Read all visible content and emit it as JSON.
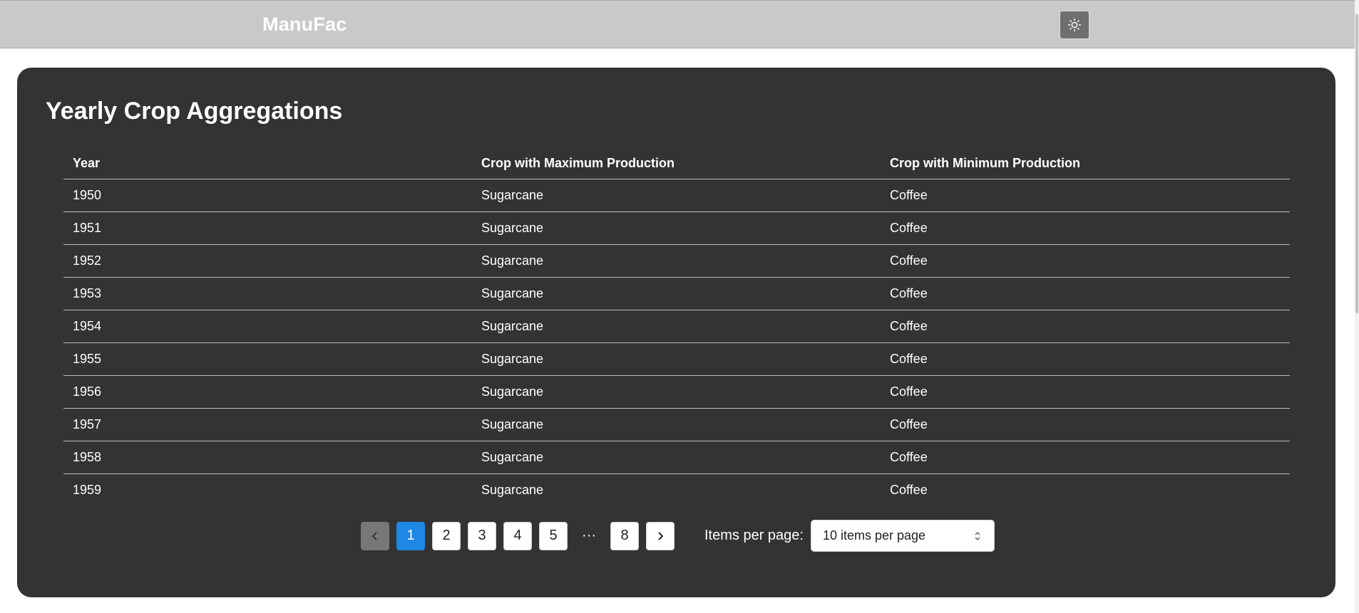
{
  "header": {
    "brand": "ManuFac",
    "theme_toggle_icon": "sun-icon"
  },
  "main": {
    "title": "Yearly Crop Aggregations",
    "table": {
      "columns": [
        "Year",
        "Crop with Maximum Production",
        "Crop with Minimum Production"
      ],
      "rows": [
        [
          "1950",
          "Sugarcane",
          "Coffee"
        ],
        [
          "1951",
          "Sugarcane",
          "Coffee"
        ],
        [
          "1952",
          "Sugarcane",
          "Coffee"
        ],
        [
          "1953",
          "Sugarcane",
          "Coffee"
        ],
        [
          "1954",
          "Sugarcane",
          "Coffee"
        ],
        [
          "1955",
          "Sugarcane",
          "Coffee"
        ],
        [
          "1956",
          "Sugarcane",
          "Coffee"
        ],
        [
          "1957",
          "Sugarcane",
          "Coffee"
        ],
        [
          "1958",
          "Sugarcane",
          "Coffee"
        ],
        [
          "1959",
          "Sugarcane",
          "Coffee"
        ]
      ]
    },
    "pagination": {
      "prev_icon": "chevron-left-icon",
      "next_icon": "chevron-right-icon",
      "pages": [
        "1",
        "2",
        "3",
        "4",
        "5"
      ],
      "ellipsis": "···",
      "last_page": "8",
      "current_page": "1",
      "items_per_page_label": "Items per page:",
      "items_per_page_value": "10 items per page"
    }
  },
  "colors": {
    "header_bg": "#c9c9c9",
    "card_bg": "#333333",
    "active_page": "#1e88e5"
  }
}
